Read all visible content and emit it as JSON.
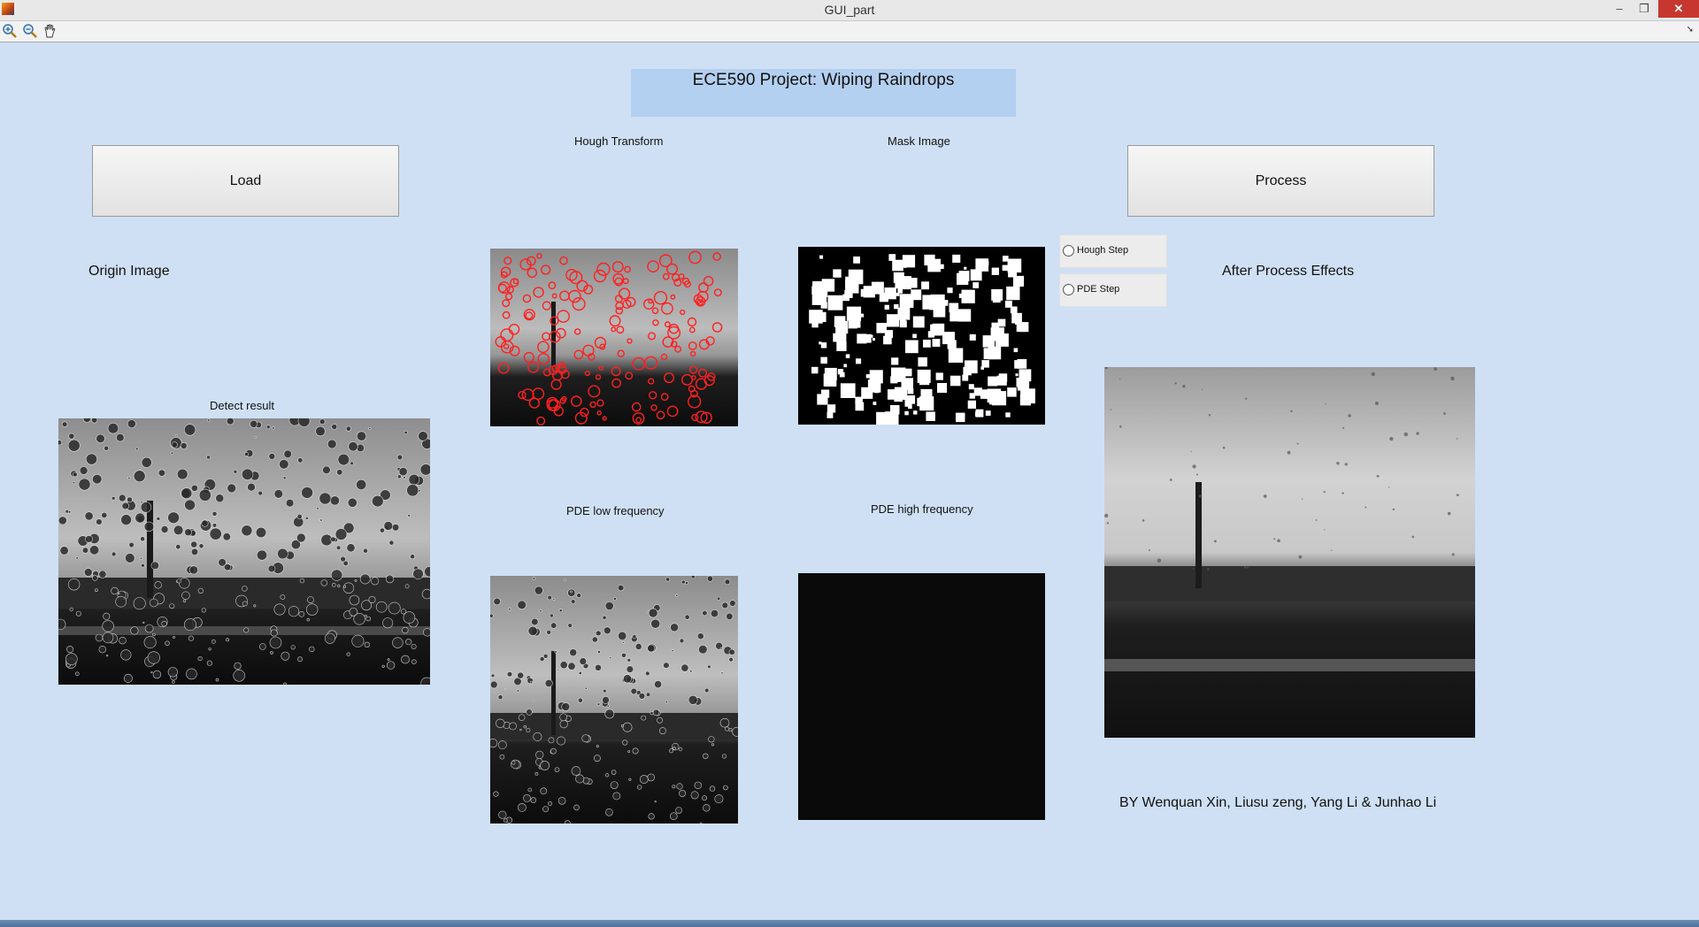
{
  "window": {
    "title": "GUI_part",
    "minimize_glyph": "–",
    "restore_glyph": "❐",
    "close_glyph": "✕"
  },
  "toolbar": {
    "icons": [
      "zoom-in-icon",
      "zoom-out-icon",
      "pan-hand-icon"
    ],
    "dock_glyph": "➘"
  },
  "header": {
    "title": "ECE590 Project: Wiping Raindrops"
  },
  "buttons": {
    "load": "Load",
    "process": "Process"
  },
  "labels": {
    "origin_image": "Origin Image",
    "detect_result": "Detect result",
    "hough_transform": "Hough Transform",
    "mask_image": "Mask Image",
    "pde_low": "PDE low frequency",
    "pde_high": "PDE high frequency",
    "after_process": "After Process Effects",
    "credits": "BY Wenquan Xin, Liusu zeng, Yang Li & Junhao Li"
  },
  "options": {
    "hough_step": "Hough Step",
    "pde_step": "PDE Step"
  },
  "colors": {
    "figure_bg": "#cfe0f5",
    "title_panel_bg": "#b4d0f0",
    "hough_circle": "#ff2020"
  }
}
